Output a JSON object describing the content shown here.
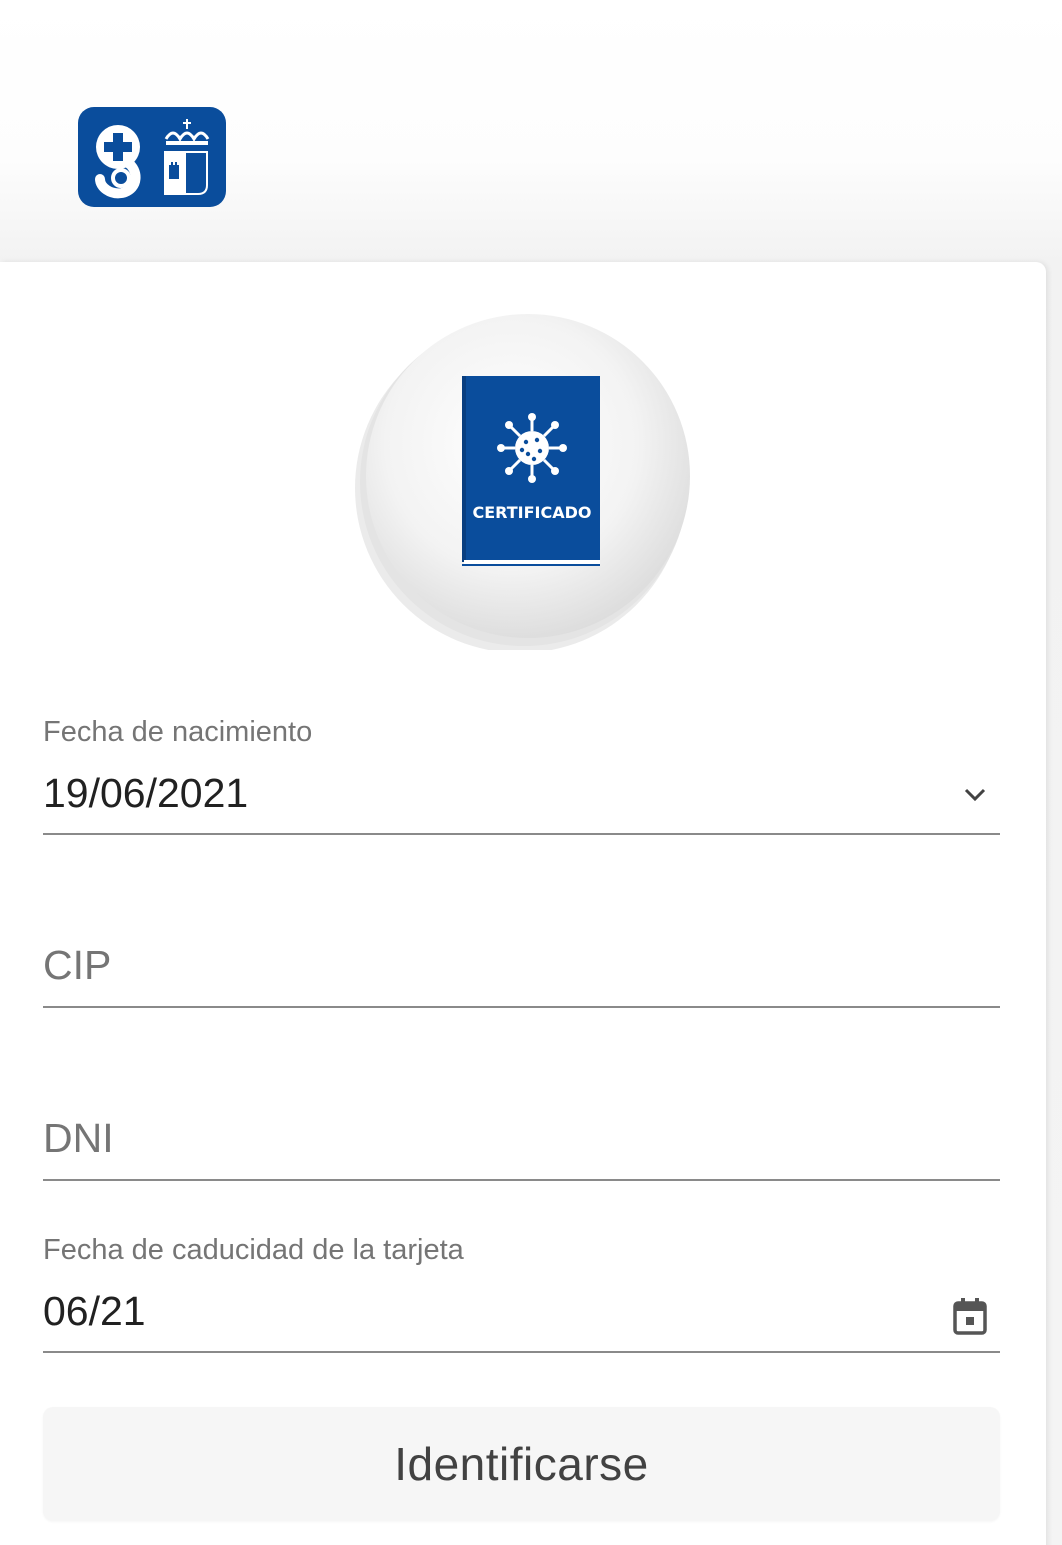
{
  "header": {
    "logo_icon": "sescam-logo-icon",
    "brand_color": "#0a4d9c"
  },
  "badge": {
    "icon": "certificate-book-icon",
    "text": "CERTIFICADO",
    "color": "#0a4d9c"
  },
  "form": {
    "birth_date": {
      "label": "Fecha de nacimiento",
      "value": "19/06/2021",
      "icon": "chevron-down-icon"
    },
    "cip": {
      "placeholder": "CIP"
    },
    "dni": {
      "placeholder": "DNI"
    },
    "card_expiry": {
      "label": "Fecha de caducidad de la tarjeta",
      "value": "06/21",
      "icon": "calendar-icon"
    },
    "submit_label": "Identificarse"
  }
}
